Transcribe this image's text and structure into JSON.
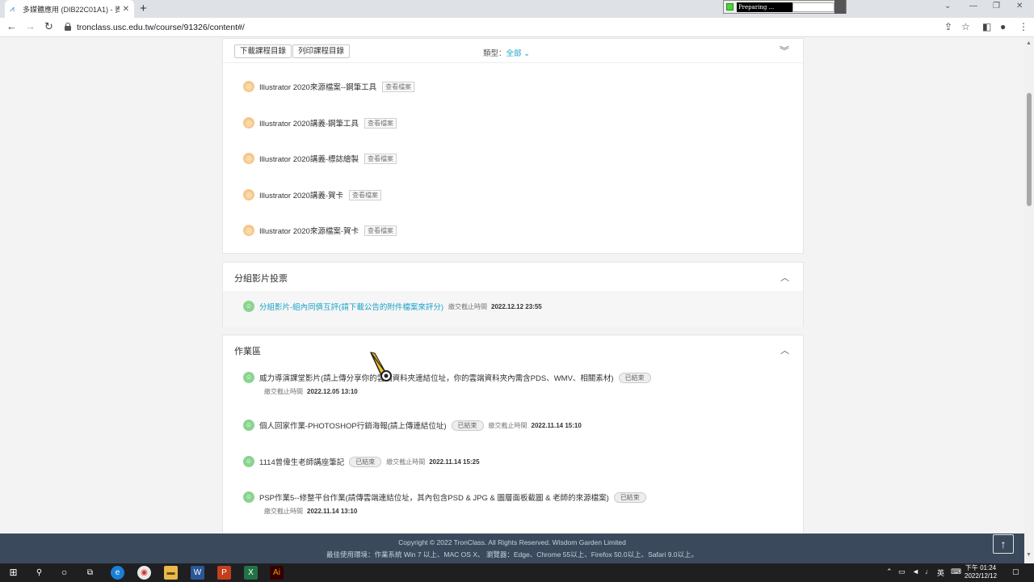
{
  "browser": {
    "tab_title": "多媒體應用 (DIB22C01A1) - 資...",
    "tab_close": "✕",
    "new_tab": "+",
    "preparing": "Preparing ...",
    "url": "tronclass.usc.edu.tw/course/91326/content#/"
  },
  "toolbar": {
    "download_label": "下載課程目錄",
    "print_label": "列印課程目錄",
    "type_label": "類型：",
    "type_value": "全部"
  },
  "materials": [
    {
      "name": "Illustrator 2020來源檔案--鋼筆工具",
      "action": "查看檔案"
    },
    {
      "name": "Illustrator 2020講義-鋼筆工具",
      "action": "查看檔案"
    },
    {
      "name": "Illustrator 2020講義-標誌繪製",
      "action": "查看檔案"
    },
    {
      "name": "Illustrator 2020講義-賀卡",
      "action": "查看檔案"
    },
    {
      "name": "Illustrator 2020來源檔案-賀卡",
      "action": "查看檔案"
    }
  ],
  "vote_section": {
    "title": "分組影片投票",
    "item": {
      "name": "分組影片-組內同儕互評(請下載公告的附件檔案來評分)",
      "deadline_label": "繳交截止時間",
      "deadline": "2022.12.12 23:55"
    }
  },
  "homework_section": {
    "title": "作業區",
    "items": [
      {
        "name": "威力導演課堂影片(請上傳分享你的雲端資料夾連結位址，你的雲端資料夾內需含PDS、WMV、相關素材)",
        "status": "已結束",
        "deadline_label": "繳交截止時間",
        "deadline": "2022.12.05 13:10"
      },
      {
        "name": "個人回家作業-PHOTOSHOP行銷海報(請上傳連結位址)",
        "status": "已結束",
        "deadline_label": "繳交截止時間",
        "deadline": "2022.11.14 15:10"
      },
      {
        "name": "1114曾偉生老師講座筆記",
        "status": "已結束",
        "deadline_label": "繳交截止時間",
        "deadline": "2022.11.14 15:25"
      },
      {
        "name": "PSP作業5--修整平台作業(請傳雲端連結位址，其內包含PSD & JPG & 圖層面板截圖 & 老師的來源檔案)",
        "status": "已結束",
        "deadline_label": "繳交截止時間",
        "deadline": "2022.11.14 13:10"
      }
    ]
  },
  "footer": {
    "copyright": "Copyright © 2022 TronClass. All Rights Reserved. Wisdom Garden Limited",
    "requirements": "最佳使用環境：作業系統 Win 7 以上、MAC OS X、 瀏覽器：Edge、Chrome 55以上、Firefox 50.0以上、Safari 9.0以上。"
  },
  "taskbar": {
    "ime": "英",
    "time": "下午 01:24",
    "date": "2022/12/12"
  },
  "colors": {
    "accent": "#1ba2c8",
    "footer_bg": "#3a4a5c",
    "file_icon": "#f6c88a",
    "task_icon": "#8bd48f"
  }
}
